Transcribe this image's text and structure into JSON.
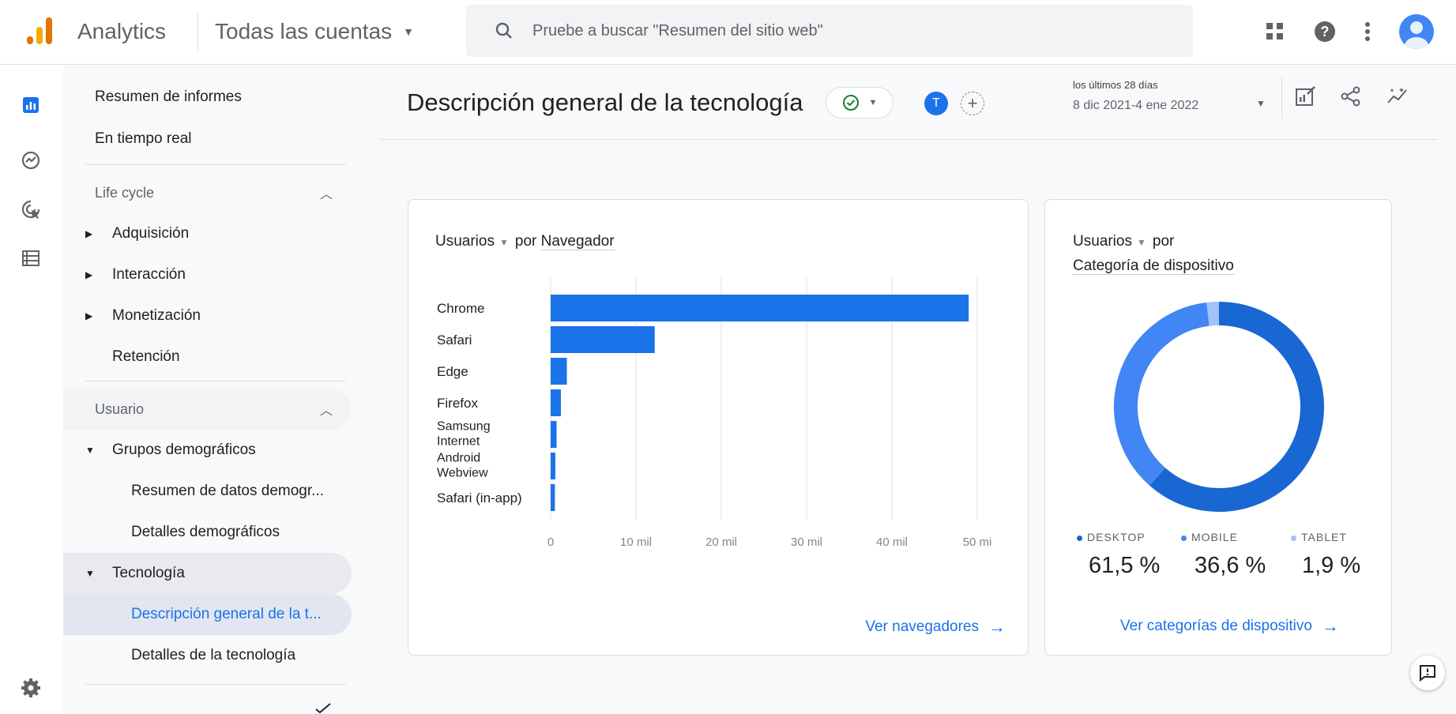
{
  "header": {
    "app_name": "Analytics",
    "account": "Todas las cuentas",
    "search_placeholder": "Pruebe a buscar \"Resumen del sitio web\""
  },
  "sidenav": {
    "items": [
      {
        "label": "Resumen de informes"
      },
      {
        "label": "En tiempo real"
      },
      {
        "label": "Life cycle"
      },
      {
        "label": "Adquisición"
      },
      {
        "label": "Interacción"
      },
      {
        "label": "Monetización"
      },
      {
        "label": "Retención"
      },
      {
        "label": "Usuario"
      },
      {
        "label": "Grupos demográficos"
      },
      {
        "label": "Resumen de datos demogr..."
      },
      {
        "label": "Detalles demográficos"
      },
      {
        "label": "Tecnología"
      },
      {
        "label": "Descripción general de la t..."
      },
      {
        "label": "Detalles de la tecnología"
      }
    ]
  },
  "page": {
    "title": "Descripción general de la tecnología",
    "avatar_letter": "T",
    "date_label": "los últimos 28 días",
    "date_range": "8 dic 2021-4 ene 2022"
  },
  "browser_card": {
    "metric": "Usuarios",
    "by": "por",
    "dimension": "Navegador",
    "link": "Ver navegadores"
  },
  "device_card": {
    "metric": "Usuarios",
    "by": "por",
    "dimension": "Categoría de dispositivo",
    "link": "Ver categorías de dispositivo",
    "segments": [
      {
        "name": "DESKTOP",
        "value": "61,5 %",
        "fraction": 0.615,
        "color": "#1967d2"
      },
      {
        "name": "MOBILE",
        "value": "36,6 %",
        "fraction": 0.366,
        "color": "#4285f4"
      },
      {
        "name": "TABLET",
        "value": "1,9 %",
        "fraction": 0.019,
        "color": "#a1c2fa"
      }
    ]
  },
  "colors": {
    "accent": "#1a73e8",
    "bar": "#1a73e8"
  },
  "chart_data": [
    {
      "type": "bar",
      "orientation": "horizontal",
      "categories": [
        "Chrome",
        "Safari",
        "Edge",
        "Firefox",
        "Samsung Internet",
        "Android Webview",
        "Safari (in-app)"
      ],
      "category_lines": [
        [
          "Chrome"
        ],
        [
          "Safari"
        ],
        [
          "Edge"
        ],
        [
          "Firefox"
        ],
        [
          "Samsung",
          "Internet"
        ],
        [
          "Android",
          "Webview"
        ],
        [
          "Safari (in-app)"
        ]
      ],
      "values": [
        49000,
        12200,
        1900,
        1200,
        700,
        550,
        500
      ],
      "xlim": [
        0,
        50000
      ],
      "x_ticks": [
        0,
        10000,
        20000,
        30000,
        40000,
        50000
      ],
      "x_tick_labels": [
        "0",
        "10 mil",
        "20 mil",
        "30 mil",
        "40 mil",
        "50 mi"
      ],
      "grid": true
    },
    {
      "type": "pie",
      "style": "donut",
      "categories": [
        "DESKTOP",
        "MOBILE",
        "TABLET"
      ],
      "values": [
        61.5,
        36.6,
        1.9
      ]
    }
  ]
}
